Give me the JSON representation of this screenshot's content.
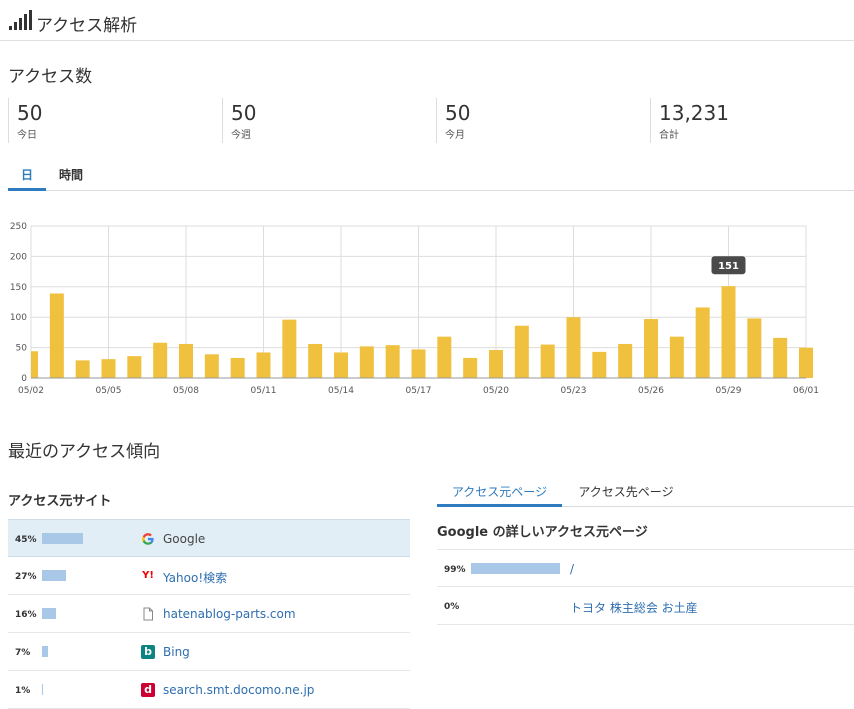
{
  "header": {
    "title": "アクセス解析",
    "icon": "signal-bars-icon"
  },
  "access_count": {
    "title": "アクセス数",
    "stats": [
      {
        "value": "50",
        "label": "今日"
      },
      {
        "value": "50",
        "label": "今週"
      },
      {
        "value": "50",
        "label": "今月"
      },
      {
        "value": "13,231",
        "label": "合計"
      }
    ]
  },
  "tabs": [
    {
      "label": "日",
      "active": true
    },
    {
      "label": "時間",
      "active": false
    }
  ],
  "chart_data": {
    "type": "bar",
    "categories": [
      "05/02",
      "05/03",
      "05/04",
      "05/05",
      "05/06",
      "05/07",
      "05/08",
      "05/09",
      "05/10",
      "05/11",
      "05/12",
      "05/13",
      "05/14",
      "05/15",
      "05/16",
      "05/17",
      "05/18",
      "05/19",
      "05/20",
      "05/21",
      "05/22",
      "05/23",
      "05/24",
      "05/25",
      "05/26",
      "05/27",
      "05/28",
      "05/29",
      "05/30",
      "05/31",
      "06/01"
    ],
    "values": [
      44,
      139,
      29,
      31,
      36,
      58,
      56,
      39,
      33,
      42,
      96,
      56,
      42,
      52,
      54,
      47,
      68,
      33,
      46,
      86,
      55,
      100,
      43,
      56,
      97,
      68,
      116,
      151,
      98,
      66,
      50
    ],
    "xticks": [
      "05/02",
      "05/05",
      "05/08",
      "05/11",
      "05/14",
      "05/17",
      "05/20",
      "05/23",
      "05/26",
      "05/29",
      "06/01"
    ],
    "yticks": [
      0,
      50,
      100,
      150,
      200,
      250
    ],
    "ylim": [
      0,
      250
    ],
    "tooltip": {
      "category": "05/29",
      "label": "151"
    },
    "bar_color": "#f0c13e",
    "grid": true
  },
  "trend": {
    "title": "最近のアクセス傾向",
    "sources_title": "アクセス元サイト",
    "sources": [
      {
        "pct_label": "45%",
        "pct": 45,
        "name": "Google",
        "icon": "google-icon"
      },
      {
        "pct_label": "27%",
        "pct": 27,
        "name": "Yahoo!検索",
        "icon": "yahoo-icon"
      },
      {
        "pct_label": "16%",
        "pct": 16,
        "name": "hatenablog-parts.com",
        "icon": "document-icon"
      },
      {
        "pct_label": "7%",
        "pct": 7,
        "name": "Bing",
        "icon": "bing-icon"
      },
      {
        "pct_label": "1%",
        "pct": 1,
        "name": "search.smt.docomo.ne.jp",
        "icon": "docomo-icon"
      }
    ],
    "right_tabs": [
      {
        "label": "アクセス元ページ",
        "active": true
      },
      {
        "label": "アクセス先ページ",
        "active": false
      }
    ],
    "detail_title": "Google の詳しいアクセス元ページ",
    "pages": [
      {
        "pct_label": "99%",
        "pct": 99,
        "name": "/"
      },
      {
        "pct_label": "0%",
        "pct": 0,
        "name": "トヨタ 株主総会 お土産"
      }
    ]
  },
  "colors": {
    "accent": "#2e7bbf",
    "bar": "#f0c13e",
    "highlight": "#e2eef6",
    "pct_bar": "#a9c8e8",
    "link": "#2e6eb0"
  }
}
